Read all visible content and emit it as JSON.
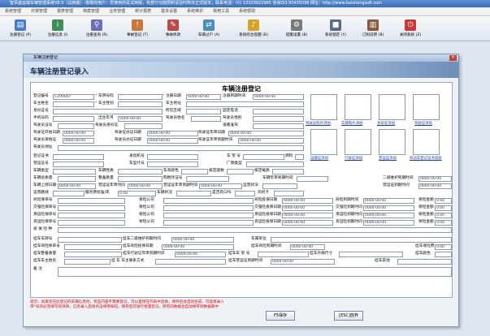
{
  "window": {
    "title": "智百盛运输车辆管理系统V8.0（试用版）-尊敬的用户：您使用的是试用版，有部分功能限制请及时购买正式版本，联系电话：(0) 13329922985 咨询QQ:93435098 网址：http://www.baishengsoft.com"
  },
  "menu": [
    "系统管理",
    "日常管理",
    "报表管理",
    "档案管理",
    "业务管理",
    "统计报表",
    "基本设置",
    "系统维护",
    "常用工具",
    "系统帮助"
  ],
  "toolbar": [
    {
      "label": "注册登记 (P)",
      "icon": "document-icon"
    },
    {
      "label": "注册信息 (I)",
      "icon": "info-icon"
    },
    {
      "label": "注册查询 (R)",
      "icon": "search-icon"
    },
    {
      "label": "事故登记 (T)",
      "icon": "alert-icon"
    },
    {
      "label": "事故修改",
      "icon": "edit-icon"
    },
    {
      "label": "车辆过户 (A)",
      "icon": "transfer-icon"
    },
    {
      "label": "系统综合提醒 (B)",
      "icon": "bell-icon"
    },
    {
      "label": "提醒设置 (B)",
      "icon": "gear-icon"
    },
    {
      "label": "系统锁定 (Y)",
      "icon": "lock-icon"
    },
    {
      "label": "订购说明 (B)",
      "icon": "book-icon"
    },
    {
      "label": "关闭系统 (Z)",
      "icon": "power-icon"
    }
  ],
  "child": {
    "title": "车辆注册登记",
    "banner": "车辆注册登记录入",
    "form_title": "车辆注册登记"
  },
  "fields": {
    "reg_no_label": "登记编号",
    "reg_no": "CZ00007",
    "plate_label": "车牌号码",
    "reg_date_label": "注册日期",
    "reg_date": "0000-00-00",
    "reg_exp_label": "注册到期时间",
    "reg_exp": "0000-00-00",
    "owner_label": "车主姓名",
    "owner_gender_label": "车主性别",
    "owner_addr_label": "车主地址",
    "id_label": "身份证号",
    "region_label": "所在区域",
    "phone_label": "固定电话",
    "mobile_label": "手机号码",
    "birth_label": "出生年月",
    "birth": "0000-00-00",
    "driver_name_label": "驾驶员姓名",
    "driver_gender_label": "驾驶员性别",
    "driver_cert_label": "驾驶员证号",
    "driver_id_label": "驾驶员身份证",
    "road_permit_label": "道路准驾",
    "lic_start_label": "驾驶证开始日期",
    "lic_start": "0000-00-00",
    "lic_issue_label": "驾驶证办证日期",
    "lic_issue": "0000-00-00",
    "lic_review_label": "驾驶证年审日期",
    "lic_review": "0000-00-00",
    "qual_start_label": "驾驶员资格证",
    "qual_start": "0000-00-00",
    "qual_issue_label": "驾驶员办证日期",
    "qual_issue": "0000-00-00",
    "qual_review_label": "驾驶证年审到期时间",
    "qual_review": "0000-00-00",
    "driver_addr_label": "驾驶员地址",
    "reg_book_label": "登记证书",
    "engine_label": "发动机号",
    "frame_label": "车 架 号",
    "fuel_label": "燃料",
    "op_cert_label": "营运证号",
    "vehicle_model_label": "车型代号",
    "factory_type_label": "厂牌类型",
    "vehicle_type_label": "车辆类型",
    "vehicle_nature_label": "车辆性质",
    "body_color_label": "车身颜色",
    "seats_label": "核定座数",
    "load_label": "核定载质",
    "total_mass_label": "车辆总质量",
    "curb_label": "整备质量",
    "purchase_tax_label": "购税凭证号",
    "annual_exp_label": "车辆年审到期时间",
    "maint_date_label": "二级维护到期时间",
    "maint_date": "0000-00-00",
    "annual_date_label": "车辆上牌日期",
    "annual_date": "0000-00-00",
    "op_review_label": "营运证年审时间",
    "op_review": "0000-00-00",
    "op_review_exp_label": "营运证年审到期时间",
    "op_review_exp": "0000-00-00",
    "op_status_label": "运营状况",
    "op_valid_label": "营运证到期时间",
    "op_valid": "0000-00-00",
    "route_label": "运营路线",
    "service_fee_label": "服务费标准/年",
    "service_fee": "0.00",
    "vehicle_status_label": "车辆状况",
    "gps_label": "是否有GPS",
    "gps_brand_label": "司机卡",
    "ins_policy1_label": "商险保单号",
    "ins_co1_label": "保险公司",
    "ins_date1_label": "商险投保日期",
    "ins_date1": "0000-00-00",
    "ins_exp1_label": "商险到期时间",
    "ins_exp1": "0000-00-00",
    "ins_amt1_label": "保险金额",
    "ins_amt1": "0.00",
    "ins_policy2_label": "交强险保单号",
    "ins_co2_label": "保险公司",
    "ins_date2_label": "交强险投保日期",
    "ins_date2": "0000-00-00",
    "ins_exp2_label": "交强险到期时间",
    "ins_exp2": "0000-00-00",
    "ins_amt2_label": "保险金额",
    "ins_amt2": "0.00",
    "ins_policy3_label": "承运险保单号",
    "ins_co3_label": "保险公司",
    "ins_date3_label": "承运险投保日期",
    "ins_date3": "0000-00-00",
    "ins_exp3_label": "承运险到期时间",
    "ins_exp3": "0000-00-00",
    "ins_amt3_label": "保险金额",
    "ins_amt3": "0.00",
    "ins_policy4_label": "货运险保单号",
    "ins_co4_label": "保险公司",
    "ins_date4_label": "货运险投保日期",
    "ins_date4": "0000-00-00",
    "ins_exp4_label": "货运险到期时间",
    "ins_exp4": "0000-00-00",
    "ins_amt4_label": "保险金额",
    "ins_amt4": "0.00",
    "ins_type_label": "投 保 险 种",
    "trailer_plate_label": "挂车车牌号",
    "trailer_maint_label": "挂车二级维护到期时间",
    "trailer_maint": "0000-00-00",
    "vehicle_unit_label": "车属单位",
    "trailer_ins_label": "挂车商险保单号",
    "trailer_ins_date_label": "挂车商险投保日期",
    "trailer_ins_date": "0000-00-00",
    "trailer_ins_exp_label": "挂车商险到期时间",
    "trailer_ins_exp": "0000-00-00",
    "trailer_fee_label": "挂车保险费",
    "trailer_fee": "0.00",
    "trailer_mass_label": "挂车整备质量",
    "trailer_review_label": "挂车行驶证年审到期时间",
    "trailer_review": "0000-00-00",
    "trailer_frame_label": "挂车车 架 号",
    "trailer_size_label": "挂车外廓尺寸",
    "trailer_color_label": "挂车颜色",
    "trailer_owner_label": "挂车车主姓名",
    "trailer_contact_label": "挂 车 车主联系方式",
    "trailer_cert_exp_label": "挂车营运证到期时间",
    "trailer_cert_exp": "0000-00-00",
    "trailer_other_label": "挂车其他",
    "remark_label": "备 注"
  },
  "photos": [
    {
      "label": "驾驶员照片添加"
    },
    {
      "label": "车辆照片添加"
    },
    {
      "label": "身份证添加"
    },
    {
      "label": "驾驶证添加"
    },
    {
      "label": "运输证添加"
    },
    {
      "label": "行驶证添加"
    },
    {
      "label": "营运证添加"
    },
    {
      "label": "机动车登记证书添加"
    }
  ],
  "note": {
    "line1": "提示：如果您在此登记的车辆信息时，有些内容不需要登记，可以直接在列表中选择，保存后会自动生成，可选择录入",
    "line2": "带*号的必须填写的项目，信息录入后请点击保存按钮，保存后可进行批量登记，所有的数据会自动保存到数据库中"
  },
  "buttons": {
    "save": "F5保存",
    "exit": "[ESC]放弃"
  },
  "colors": {
    "titlebar": "#3a6fb8",
    "banner_end": "#6f8fb8",
    "required": "#d00000",
    "link": "#1a3c9a"
  }
}
